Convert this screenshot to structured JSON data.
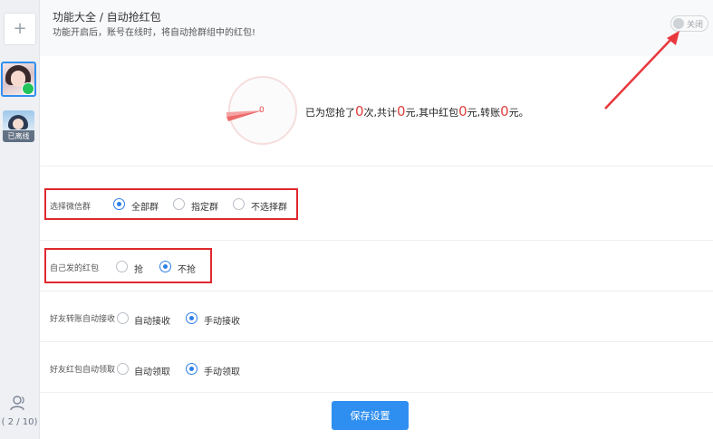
{
  "rail": {
    "add_label": "+",
    "accounts": [
      {
        "status": "online"
      },
      {
        "status_label": "已离线"
      }
    ],
    "account_count": "( 2 / 10)"
  },
  "header": {
    "title": "功能大全 / 自动抢红包",
    "description": "功能开启后，账号在线时，将自动抢群组中的红包!",
    "toggle_label": "关闭",
    "toggle_state": "off"
  },
  "summary": {
    "gauge_value": "0",
    "prefix": "已为您抢了",
    "times": "0",
    "times_unit": "次,共计",
    "total": "0",
    "total_unit": "元,其中红包",
    "redpacket": "0",
    "redpacket_unit": "元,转账",
    "transfer": "0",
    "transfer_unit": "元。"
  },
  "settings": {
    "group_select": {
      "label": "选择微信群",
      "options": [
        "全部群",
        "指定群",
        "不选择群"
      ],
      "selected": "全部群"
    },
    "own_redpacket": {
      "label": "自己发的红包",
      "options": [
        "抢",
        "不抢"
      ],
      "selected": "不抢"
    },
    "friend_transfer": {
      "label": "好友转账自动接收",
      "options": [
        "自动接收",
        "手动接收"
      ],
      "selected": "手动接收"
    },
    "friend_redpacket": {
      "label": "好友红包自动领取",
      "options": [
        "自动领取",
        "手动领取"
      ],
      "selected": "手动领取"
    }
  },
  "actions": {
    "save_label": "保存设置"
  },
  "colors": {
    "accent": "#2f8ff0",
    "highlight": "#e0282f",
    "amount": "#e0413f"
  }
}
